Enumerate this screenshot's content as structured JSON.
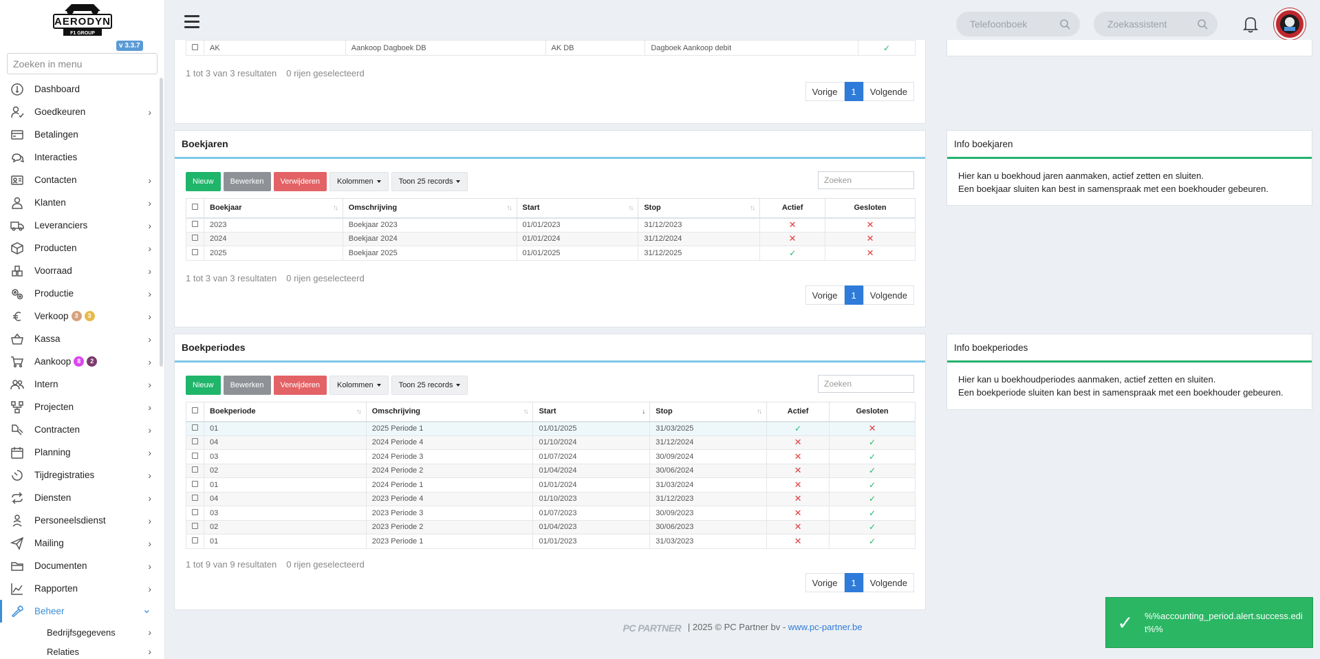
{
  "sidebar": {
    "logo_text": "AERODYN",
    "logo_sub": "F1 GROUP",
    "version": "v 3.3.7",
    "search_placeholder": "Zoeken in menu",
    "items": [
      {
        "label": "Dashboard",
        "icon": "dashboard-icon",
        "chev": false
      },
      {
        "label": "Goedkeuren",
        "icon": "user-check-icon",
        "chev": true
      },
      {
        "label": "Betalingen",
        "icon": "credit-card-icon",
        "chev": false
      },
      {
        "label": "Interacties",
        "icon": "chat-icon",
        "chev": false
      },
      {
        "label": "Contacten",
        "icon": "contact-card-icon",
        "chev": true
      },
      {
        "label": "Klanten",
        "icon": "customer-icon",
        "chev": true
      },
      {
        "label": "Leveranciers",
        "icon": "truck-icon",
        "chev": true
      },
      {
        "label": "Producten",
        "icon": "box-icon",
        "chev": true
      },
      {
        "label": "Voorraad",
        "icon": "stock-icon",
        "chev": true
      },
      {
        "label": "Productie",
        "icon": "gears-icon",
        "chev": true
      },
      {
        "label": "Verkoop",
        "icon": "euro-icon",
        "chev": true,
        "badges": [
          {
            "text": "3",
            "color": "#d4a27c"
          },
          {
            "text": "3",
            "color": "#e8b84a"
          }
        ]
      },
      {
        "label": "Kassa",
        "icon": "basket-icon",
        "chev": true
      },
      {
        "label": "Aankoop",
        "icon": "cart-icon",
        "chev": true,
        "badges": [
          {
            "text": "8",
            "color": "#d946ef"
          },
          {
            "text": "2",
            "color": "#7b3a6b"
          }
        ]
      },
      {
        "label": "Intern",
        "icon": "users-icon",
        "chev": true
      },
      {
        "label": "Projecten",
        "icon": "project-icon",
        "chev": true
      },
      {
        "label": "Contracten",
        "icon": "contract-icon",
        "chev": true
      },
      {
        "label": "Planning",
        "icon": "calendar-icon",
        "chev": true
      },
      {
        "label": "Tijdregistraties",
        "icon": "timer-icon",
        "chev": true
      },
      {
        "label": "Diensten",
        "icon": "repeat-icon",
        "chev": true
      },
      {
        "label": "Personeelsdienst",
        "icon": "staff-icon",
        "chev": true
      },
      {
        "label": "Mailing",
        "icon": "send-icon",
        "chev": true
      },
      {
        "label": "Documenten",
        "icon": "folder-icon",
        "chev": true
      },
      {
        "label": "Rapporten",
        "icon": "chart-icon",
        "chev": true
      },
      {
        "label": "Beheer",
        "icon": "wrench-icon",
        "chev": true,
        "active": true
      }
    ],
    "sub_items": [
      {
        "label": "Bedrijfsgegevens"
      },
      {
        "label": "Relaties"
      }
    ]
  },
  "topbar": {
    "phonebook_placeholder": "Telefoonboek",
    "assistant_placeholder": "Zoekassistent"
  },
  "journals_partial": {
    "row": {
      "code": "AK",
      "desc": "Aankoop Dagboek DB",
      "short": "AK DB",
      "type": "Dagboek Aankoop debit"
    },
    "info": "1 tot 3 van 3 resultaten",
    "selected": "0 rijen geselecteerd"
  },
  "boekjaren": {
    "title": "Boekjaren",
    "buttons": {
      "new": "Nieuw",
      "edit": "Bewerken",
      "delete": "Verwijderen",
      "columns": "Kolommen",
      "show": "Toon 25 records"
    },
    "search_placeholder": "Zoeken",
    "columns": [
      "Boekjaar",
      "Omschrijving",
      "Start",
      "Stop",
      "Actief",
      "Gesloten"
    ],
    "rows": [
      {
        "year": "2023",
        "desc": "Boekjaar 2023",
        "start": "01/01/2023",
        "stop": "31/12/2023",
        "active": false,
        "closed": false
      },
      {
        "year": "2024",
        "desc": "Boekjaar 2024",
        "start": "01/01/2024",
        "stop": "31/12/2024",
        "active": false,
        "closed": false
      },
      {
        "year": "2025",
        "desc": "Boekjaar 2025",
        "start": "01/01/2025",
        "stop": "31/12/2025",
        "active": true,
        "closed": false
      }
    ],
    "info": "1 tot 3 van 3 resultaten",
    "selected": "0 rijen geselecteerd"
  },
  "boekperiodes": {
    "title": "Boekperiodes",
    "buttons": {
      "new": "Nieuw",
      "edit": "Bewerken",
      "delete": "Verwijderen",
      "columns": "Kolommen",
      "show": "Toon 25 records"
    },
    "search_placeholder": "Zoeken",
    "columns": [
      "Boekperiode",
      "Omschrijving",
      "Start",
      "Stop",
      "Actief",
      "Gesloten"
    ],
    "rows": [
      {
        "period": "01",
        "desc": "2025 Periode 1",
        "start": "01/01/2025",
        "stop": "31/03/2025",
        "active": true,
        "closed": false
      },
      {
        "period": "04",
        "desc": "2024 Periode 4",
        "start": "01/10/2024",
        "stop": "31/12/2024",
        "active": false,
        "closed": true
      },
      {
        "period": "03",
        "desc": "2024 Periode 3",
        "start": "01/07/2024",
        "stop": "30/09/2024",
        "active": false,
        "closed": true
      },
      {
        "period": "02",
        "desc": "2024 Periode 2",
        "start": "01/04/2024",
        "stop": "30/06/2024",
        "active": false,
        "closed": true
      },
      {
        "period": "01",
        "desc": "2024 Periode 1",
        "start": "01/01/2024",
        "stop": "31/03/2024",
        "active": false,
        "closed": true
      },
      {
        "period": "04",
        "desc": "2023 Periode 4",
        "start": "01/10/2023",
        "stop": "31/12/2023",
        "active": false,
        "closed": true
      },
      {
        "period": "03",
        "desc": "2023 Periode 3",
        "start": "01/07/2023",
        "stop": "30/09/2023",
        "active": false,
        "closed": true
      },
      {
        "period": "02",
        "desc": "2023 Periode 2",
        "start": "01/04/2023",
        "stop": "30/06/2023",
        "active": false,
        "closed": true
      },
      {
        "period": "01",
        "desc": "2023 Periode 1",
        "start": "01/01/2023",
        "stop": "31/03/2023",
        "active": false,
        "closed": true
      }
    ],
    "info": "1 tot 9 van 9 resultaten",
    "selected": "0 rijen geselecteerd"
  },
  "pager": {
    "prev": "Vorige",
    "page": "1",
    "next": "Volgende"
  },
  "info_boekjaren": {
    "title": "Info boekjaren",
    "line1": "Hier kan u boekhoud jaren aanmaken, actief zetten en sluiten.",
    "line2": "Een boekjaar sluiten kan best in samenspraak met een boekhouder gebeuren."
  },
  "info_boekperiodes": {
    "title": "Info boekperiodes",
    "line1": "Hier kan u boekhoudperiodes aanmaken, actief zetten en sluiten.",
    "line2": "Een boekperiode sluiten kan best in samenspraak met een boekhouder gebeuren."
  },
  "footer": {
    "brand": "PC PARTNER",
    "sep": "|",
    "text": "2025 © PC Partner bv - ",
    "link": "www.pc-partner.be"
  },
  "toast": {
    "message": "%%accounting_period.alert.success.edit%%"
  }
}
